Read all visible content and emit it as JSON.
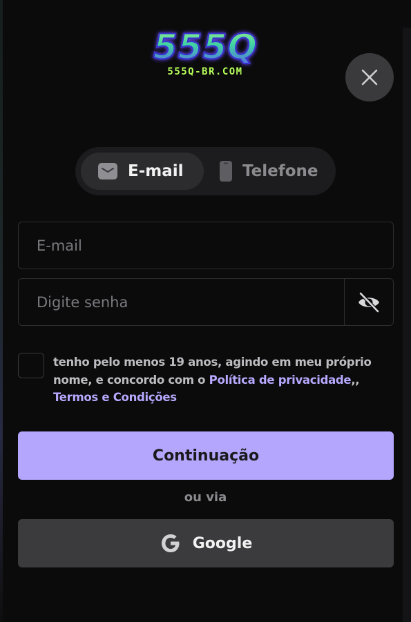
{
  "logo": {
    "main": "555Q",
    "domain": "555Q-BR.COM"
  },
  "tabs": [
    {
      "label": "E-mail",
      "icon": "mail-icon",
      "active": true
    },
    {
      "label": "Telefone",
      "icon": "phone-icon",
      "active": false
    }
  ],
  "form": {
    "email_placeholder": "E-mail",
    "email_value": "",
    "password_placeholder": "Digite senha",
    "password_value": "",
    "password_toggle_icon": "eye-off-icon",
    "agree_checked": false
  },
  "terms": {
    "text_before": "tenho pelo menos 19 anos, agindo em meu próprio nome, e concordo com o ",
    "privacy_link": "Política de privacidade",
    "separator": ",, ",
    "terms_link": "Termos e Condições"
  },
  "actions": {
    "continue_label": "Continuação",
    "or_via": "ou via",
    "google_label": "Google"
  },
  "colors": {
    "accent": "#b4a6fc",
    "link": "#b8a9ff",
    "background": "#0b0b0c"
  }
}
